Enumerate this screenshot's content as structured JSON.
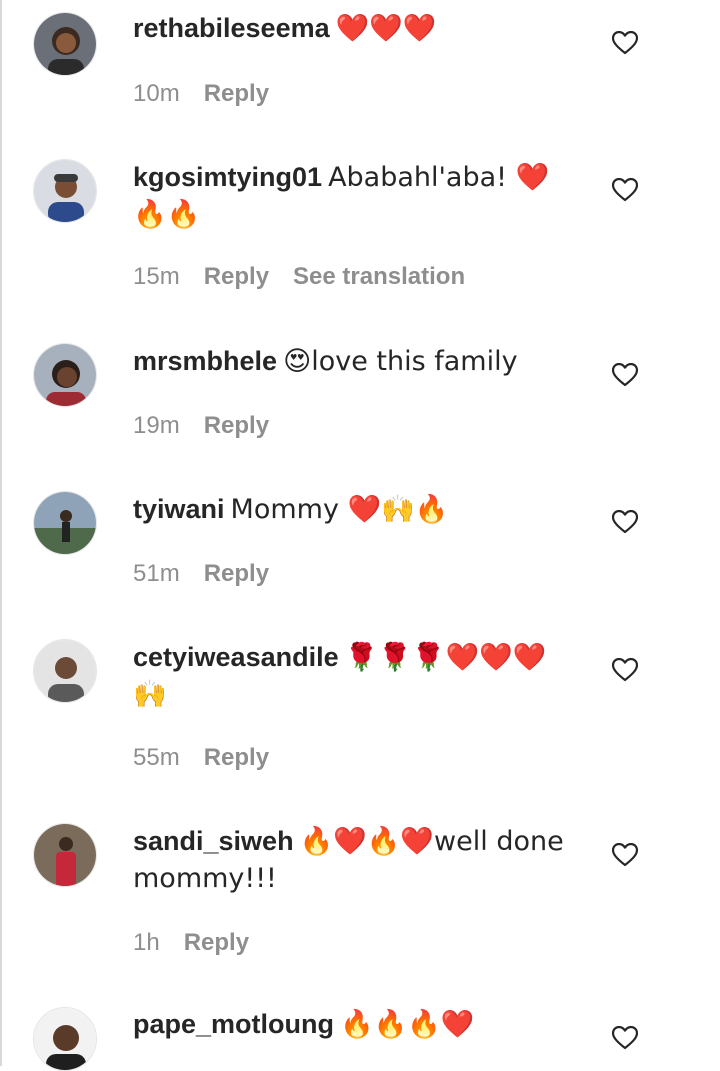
{
  "comments": [
    {
      "username": "rethabileseema",
      "text": "❤️❤️❤️",
      "time": "10m",
      "reply": "Reply",
      "translation": ""
    },
    {
      "username": "kgosimtying01",
      "text": "Ababahl'aba! ❤️🔥🔥",
      "time": "15m",
      "reply": "Reply",
      "translation": "See translation"
    },
    {
      "username": "mrsmbhele",
      "text": "😍love this family",
      "time": "19m",
      "reply": "Reply",
      "translation": ""
    },
    {
      "username": "tyiwani",
      "text": "Mommy ❤️🙌🔥",
      "time": "51m",
      "reply": "Reply",
      "translation": ""
    },
    {
      "username": "cetyiweasandile",
      "text": "🌹🌹🌹❤️❤️❤️🙌",
      "time": "55m",
      "reply": "Reply",
      "translation": ""
    },
    {
      "username": "sandi_siweh",
      "text": "🔥❤️🔥❤️well done mommy!!!",
      "time": "1h",
      "reply": "Reply",
      "translation": ""
    },
    {
      "username": "pape_motloung",
      "text": "🔥🔥🔥❤️",
      "time": "",
      "reply": "",
      "translation": ""
    }
  ],
  "icons": {
    "like": "heart-outline-icon"
  },
  "colors": {
    "primary_text": "#262626",
    "secondary_text": "#8e8e8e",
    "background": "#ffffff"
  }
}
